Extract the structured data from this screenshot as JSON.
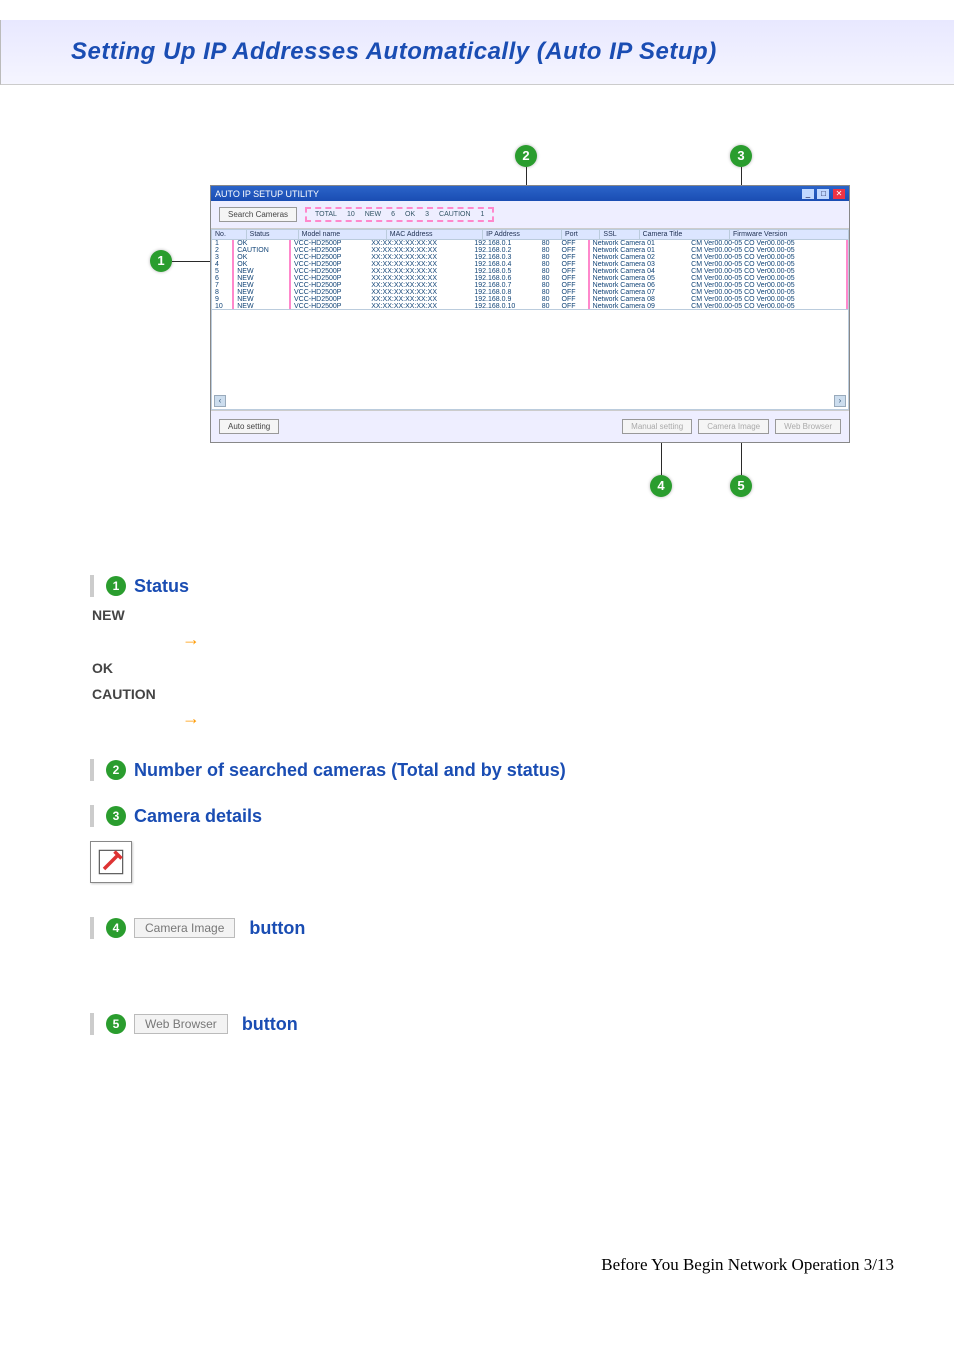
{
  "page_title": "Setting Up IP Addresses Automatically (Auto IP Setup)",
  "footer": "Before You Begin Network Operation 3/13",
  "app_window": {
    "title": "AUTO IP SETUP UTILITY",
    "toolbar": {
      "search_btn": "Search Cameras"
    },
    "counts": {
      "total_label": "TOTAL",
      "total": "10",
      "new_label": "NEW",
      "new": "6",
      "ok_label": "OK",
      "ok": "3",
      "caution_label": "CAUTION",
      "caution": "1"
    },
    "columns": {
      "no": "No.",
      "status": "Status",
      "model": "Model name",
      "mac": "MAC Address",
      "ip": "IP Address",
      "port": "Port",
      "ssl": "SSL",
      "title": "Camera Title",
      "fw": "Firmware Version"
    },
    "rows": [
      {
        "no": "1",
        "status": "OK",
        "model": "VCC-HD2500P",
        "mac": "XX:XX:XX:XX:XX:XX",
        "ip": "192.168.0.1",
        "port": "80",
        "ssl": "OFF",
        "title": "Network Camera 01",
        "fw": "CM Ver00.00-05 CO Ver00.00-05"
      },
      {
        "no": "2",
        "status": "CAUTION",
        "model": "VCC-HD2500P",
        "mac": "XX:XX:XX:XX:XX:XX",
        "ip": "192.168.0.2",
        "port": "80",
        "ssl": "OFF",
        "title": "Network Camera 01",
        "fw": "CM Ver00.00-05 CO Ver00.00-05"
      },
      {
        "no": "3",
        "status": "OK",
        "model": "VCC-HD2500P",
        "mac": "XX:XX:XX:XX:XX:XX",
        "ip": "192.168.0.3",
        "port": "80",
        "ssl": "OFF",
        "title": "Network Camera 02",
        "fw": "CM Ver00.00-05 CO Ver00.00-05"
      },
      {
        "no": "4",
        "status": "OK",
        "model": "VCC-HD2500P",
        "mac": "XX:XX:XX:XX:XX:XX",
        "ip": "192.168.0.4",
        "port": "80",
        "ssl": "OFF",
        "title": "Network Camera 03",
        "fw": "CM Ver00.00-05 CO Ver00.00-05"
      },
      {
        "no": "5",
        "status": "NEW",
        "model": "VCC-HD2500P",
        "mac": "XX:XX:XX:XX:XX:XX",
        "ip": "192.168.0.5",
        "port": "80",
        "ssl": "OFF",
        "title": "Network Camera 04",
        "fw": "CM Ver00.00-05 CO Ver00.00-05"
      },
      {
        "no": "6",
        "status": "NEW",
        "model": "VCC-HD2500P",
        "mac": "XX:XX:XX:XX:XX:XX",
        "ip": "192.168.0.6",
        "port": "80",
        "ssl": "OFF",
        "title": "Network Camera 05",
        "fw": "CM Ver00.00-05 CO Ver00.00-05"
      },
      {
        "no": "7",
        "status": "NEW",
        "model": "VCC-HD2500P",
        "mac": "XX:XX:XX:XX:XX:XX",
        "ip": "192.168.0.7",
        "port": "80",
        "ssl": "OFF",
        "title": "Network Camera 06",
        "fw": "CM Ver00.00-05 CO Ver00.00-05"
      },
      {
        "no": "8",
        "status": "NEW",
        "model": "VCC-HD2500P",
        "mac": "XX:XX:XX:XX:XX:XX",
        "ip": "192.168.0.8",
        "port": "80",
        "ssl": "OFF",
        "title": "Network Camera 07",
        "fw": "CM Ver00.00-05 CO Ver00.00-05"
      },
      {
        "no": "9",
        "status": "NEW",
        "model": "VCC-HD2500P",
        "mac": "XX:XX:XX:XX:XX:XX",
        "ip": "192.168.0.9",
        "port": "80",
        "ssl": "OFF",
        "title": "Network Camera 08",
        "fw": "CM Ver00.00-05 CO Ver00.00-05"
      },
      {
        "no": "10",
        "status": "NEW",
        "model": "VCC-HD2500P",
        "mac": "XX:XX:XX:XX:XX:XX",
        "ip": "192.168.0.10",
        "port": "80",
        "ssl": "OFF",
        "title": "Network Camera 09",
        "fw": "CM Ver00.00-05 CO Ver00.00-05"
      }
    ],
    "bottom": {
      "auto": "Auto setting",
      "manual": "Manual setting",
      "camera_image": "Camera Image",
      "web_browser": "Web Browser"
    }
  },
  "sections": {
    "s1": {
      "num": "1",
      "title": "Status",
      "items": {
        "new": "NEW",
        "ok": "OK",
        "caution": "CAUTION"
      }
    },
    "s2": {
      "num": "2",
      "title": "Number of searched cameras (Total and by status)"
    },
    "s3": {
      "num": "3",
      "title": "Camera details"
    },
    "s4": {
      "num": "4",
      "btn": "Camera Image",
      "word": "button"
    },
    "s5": {
      "num": "5",
      "btn": "Web Browser",
      "word": "button"
    }
  }
}
